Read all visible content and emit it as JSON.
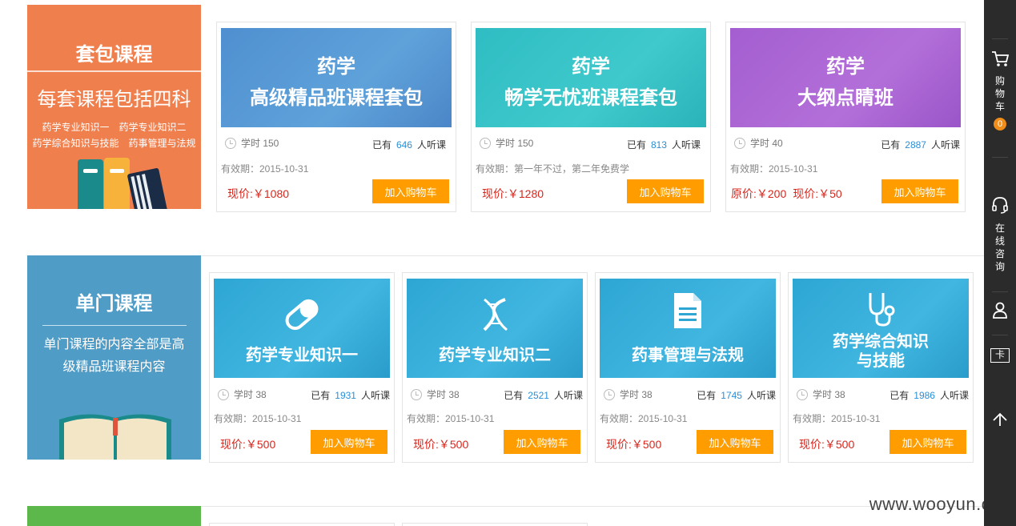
{
  "package_section": {
    "title": "套包课程",
    "subtitle": "每套课程包括四科",
    "subjects_line1": "药学专业知识一　药学专业知识二",
    "subjects_line2": "药学综合知识与技能　药事管理与法规",
    "colors": {
      "banner": "#f07f4e"
    },
    "cards": [
      {
        "thumb_title": "药学",
        "thumb_sub": "高级精品班课程套包",
        "thumb_color": "#4f8fd0",
        "hours": "学时 150",
        "listen_prefix": "已有",
        "listeners": "646",
        "listen_suffix": "人听课",
        "validity": "有效期：2015-10-31",
        "original_price": "",
        "price": "现价:￥1080",
        "button": "加入购物车"
      },
      {
        "thumb_title": "药学",
        "thumb_sub": "畅学无忧班课程套包",
        "thumb_color": "#2fbdc3",
        "hours": "学时 150",
        "listen_prefix": "已有",
        "listeners": "813",
        "listen_suffix": "人听课",
        "validity": "有效期：第一年不过，第二年免费学",
        "original_price": "",
        "price": "现价:￥1280",
        "button": "加入购物车"
      },
      {
        "thumb_title": "药学",
        "thumb_sub": "大纲点睛班",
        "thumb_color": "#a45ed0",
        "hours": "学时 40",
        "listen_prefix": "已有",
        "listeners": "2887",
        "listen_suffix": "人听课",
        "validity": "有效期：2015-10-31",
        "original_price": "原价:￥200",
        "price": "现价:￥50",
        "button": "加入购物车"
      }
    ]
  },
  "single_section": {
    "title": "单门课程",
    "description": "单门课程的内容全部是高级精品班课程内容",
    "colors": {
      "banner": "#4f9cc7"
    },
    "cards": [
      {
        "icon": "pill-icon",
        "thumb_title": "药学专业知识一",
        "hours": "学时 38",
        "listen_prefix": "已有",
        "listeners": "1931",
        "listen_suffix": "人听课",
        "validity": "有效期：2015-10-31",
        "price": "现价:￥500",
        "button": "加入购物车"
      },
      {
        "icon": "dna-icon",
        "thumb_title": "药学专业知识二",
        "hours": "学时 38",
        "listen_prefix": "已有",
        "listeners": "2521",
        "listen_suffix": "人听课",
        "validity": "有效期：2015-10-31",
        "price": "现价:￥500",
        "button": "加入购物车"
      },
      {
        "icon": "document-icon",
        "thumb_title": "药事管理与法规",
        "hours": "学时 38",
        "listen_prefix": "已有",
        "listeners": "1745",
        "listen_suffix": "人听课",
        "validity": "有效期：2015-10-31",
        "price": "现价:￥500",
        "button": "加入购物车"
      },
      {
        "icon": "stethoscope-icon",
        "thumb_title_line1": "药学综合知识",
        "thumb_title_line2": "与技能",
        "hours": "学时 38",
        "listen_prefix": "已有",
        "listeners": "1986",
        "listen_suffix": "人听课",
        "validity": "有效期：2015-10-31",
        "price": "现价:￥500",
        "button": "加入购物车"
      }
    ]
  },
  "toolbar": {
    "cart_label": "购物车",
    "cart_count": "0",
    "consult_label": "在线咨询",
    "card_label": "卡",
    "icons": [
      "cart-icon",
      "headset-icon",
      "user-icon",
      "card-icon",
      "back-to-top-icon"
    ]
  },
  "watermark": "www.wooyun.org"
}
